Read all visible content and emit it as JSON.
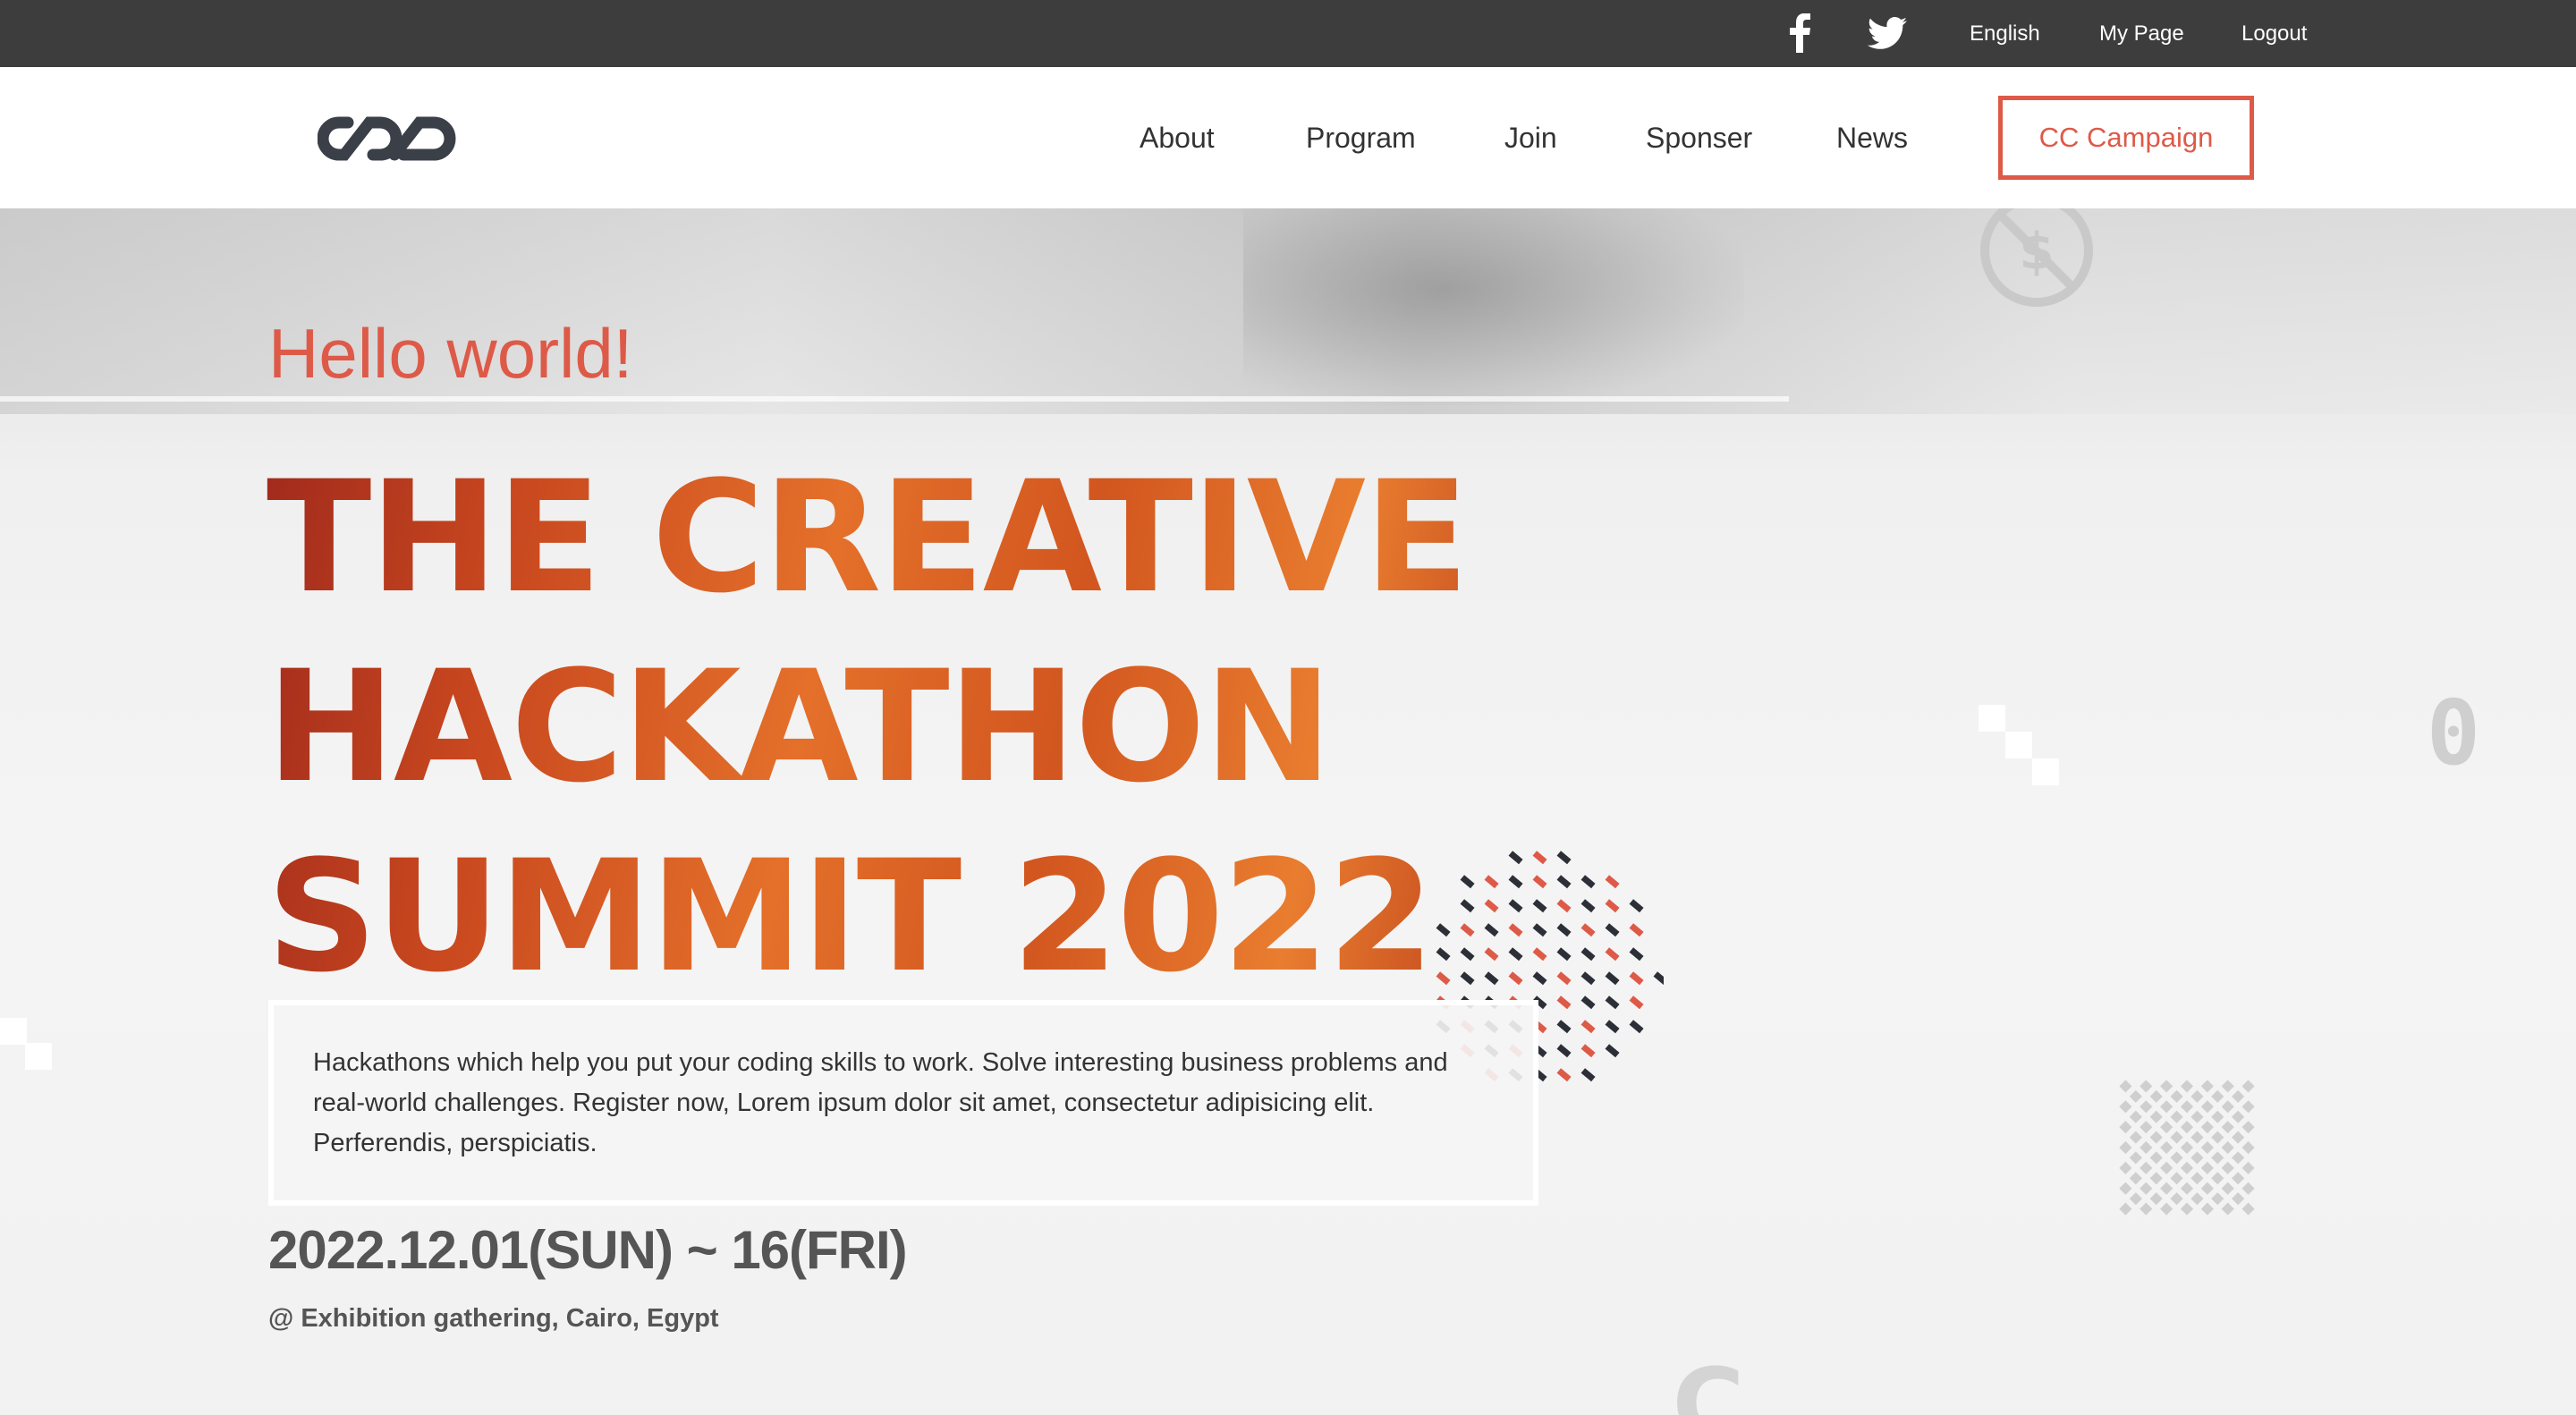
{
  "topbar": {
    "language": "English",
    "my_page": "My Page",
    "logout": "Logout"
  },
  "nav": {
    "about": "About",
    "program": "Program",
    "join": "Join",
    "sponser": "Sponser",
    "news": "News",
    "cc_campaign": "CC Campaign"
  },
  "hero": {
    "greeting": "Hello world!",
    "title_lines": [
      "THE CREATIVE",
      "HACKATHON",
      "SUMMIT 2022"
    ],
    "description": "Hackathons which help you put your coding skills to work. Solve interesting business problems and real-world challenges. Register now, Lorem ipsum dolor sit amet, consectetur adipisicing elit. Perferendis, perspiciatis.",
    "date": "2022.12.01(SUN) ~ 16(FRI)",
    "location": "@ Exhibition gathering, Cairo, Egypt"
  },
  "colors": {
    "accent": "#de5a48",
    "topbar_bg": "#3d3d3d",
    "title_gradient_start": "#a12a1c",
    "title_gradient_end": "#e97d2f"
  },
  "icons": [
    "facebook-icon",
    "twitter-icon",
    "logo-icon"
  ]
}
